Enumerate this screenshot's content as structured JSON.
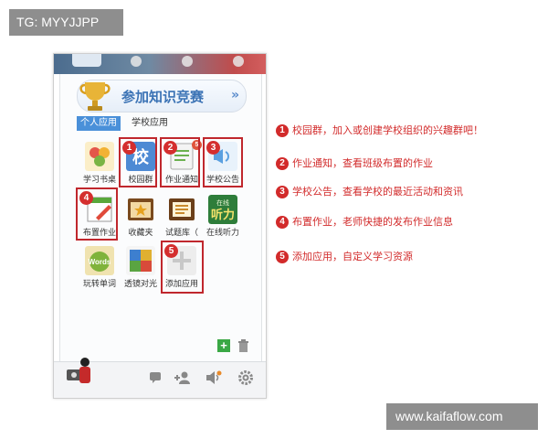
{
  "watermarks": {
    "top_left": "TG: MYYJJPP",
    "bottom_right": "www.kaifaflow.com"
  },
  "banner": {
    "text": "参加知识竞赛",
    "chevron": "»"
  },
  "tabs": [
    {
      "label": "个人应用",
      "active": true
    },
    {
      "label": "学校应用",
      "active": false
    }
  ],
  "apps": [
    {
      "label": "学习书桌",
      "icon": "desk-icon"
    },
    {
      "label": "校园群",
      "icon": "campus-group-icon",
      "badge": "1"
    },
    {
      "label": "作业通知",
      "icon": "homework-notice-icon",
      "badge": "2",
      "count": "5"
    },
    {
      "label": "学校公告",
      "icon": "school-announcement-icon",
      "badge": "3"
    },
    {
      "label": "布置作业",
      "icon": "assign-homework-icon",
      "badge": "4"
    },
    {
      "label": "收藏夹",
      "icon": "favorites-icon"
    },
    {
      "label": "试题库（",
      "icon": "question-bank-icon"
    },
    {
      "label": "在线听力",
      "icon": "online-listening-icon",
      "icon_text_top": "在线",
      "icon_text_main": "听力"
    },
    {
      "label": "玩转单词",
      "icon": "words-icon",
      "icon_text_main": "Words"
    },
    {
      "label": "透镜对光",
      "icon": "lens-icon"
    },
    {
      "label": "添加应用",
      "icon": "add-app-icon",
      "badge": "5"
    }
  ],
  "toolbar": {
    "add": "+",
    "trash": "trash-icon"
  },
  "annotations": [
    {
      "num": "1",
      "text": "校园群，加入或创建学校组织的兴趣群吧！"
    },
    {
      "num": "2",
      "text": "作业通知，查看班级布置的作业"
    },
    {
      "num": "3",
      "text": "学校公告，查看学校的最近活动和资讯"
    },
    {
      "num": "4",
      "text": "布置作业，老师快捷的发布作业信息"
    },
    {
      "num": "5",
      "text": "添加应用，自定义学习资源"
    }
  ],
  "colors": {
    "accent_red": "#d22b2b",
    "tab_blue": "#4a90d9",
    "banner_blue": "#3b73b5"
  }
}
